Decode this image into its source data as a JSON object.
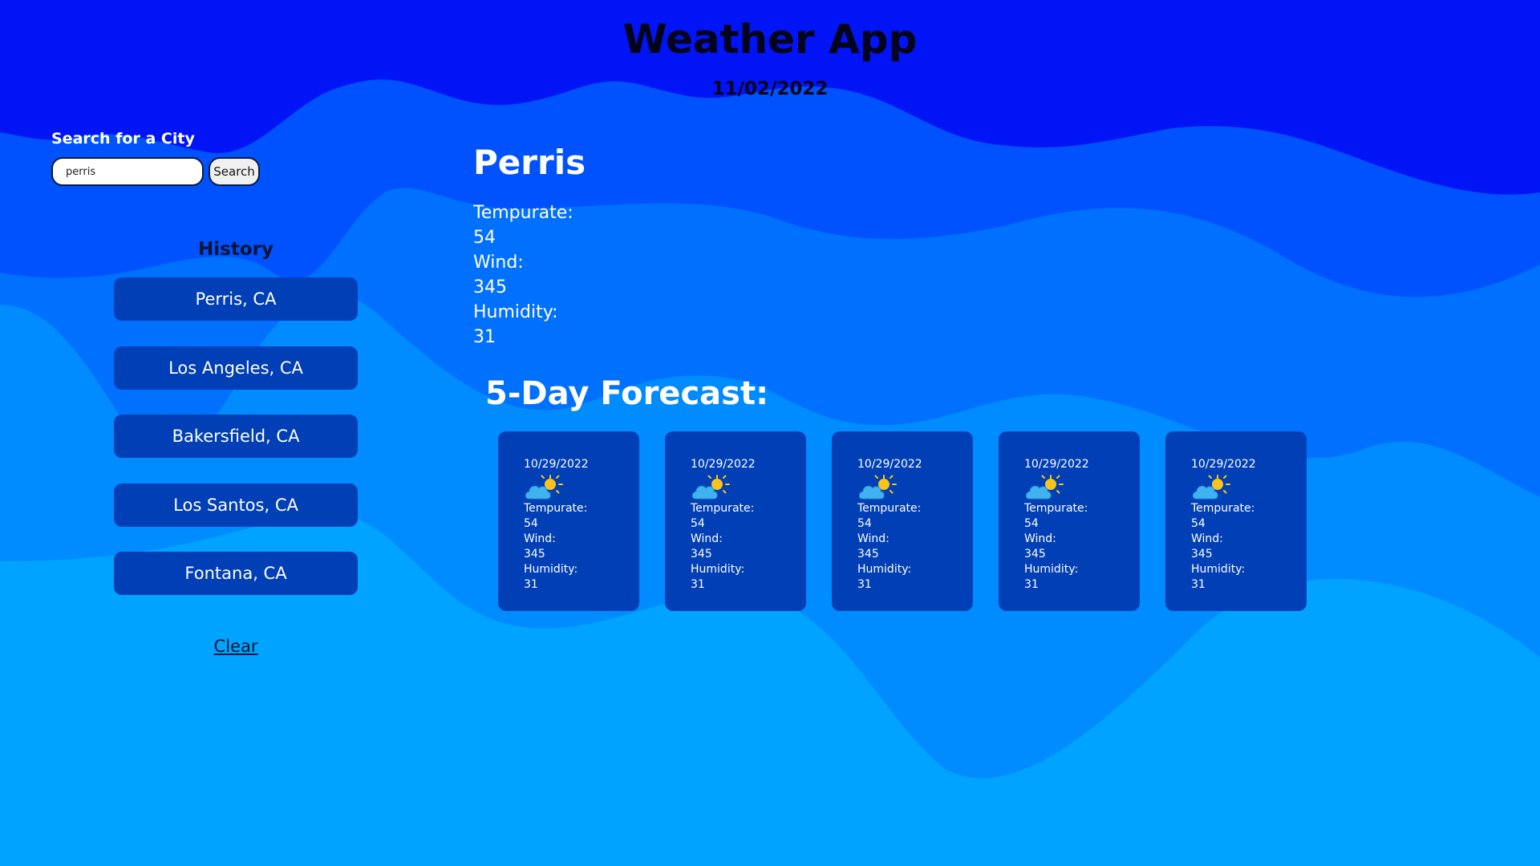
{
  "header": {
    "title": "Weather App",
    "date": "11/02/2022"
  },
  "search": {
    "label": "Search for a City",
    "input_value": "perris",
    "button_label": "Search"
  },
  "history": {
    "title": "History",
    "items": [
      "Perris, CA",
      "Los Angeles, CA",
      "Bakersfield, CA",
      "Los Santos, CA",
      "Fontana, CA"
    ],
    "clear_label": "Clear"
  },
  "current": {
    "city": "Perris",
    "temp_label": "Tempurate:",
    "temp_value": "54",
    "wind_label": "Wind:",
    "wind_value": "345",
    "humidity_label": "Humidity:",
    "humidity_value": "31"
  },
  "forecast": {
    "title": "5-Day Forecast:",
    "icon": "partly-cloudy-icon",
    "days": [
      {
        "date": "10/29/2022",
        "temp_label": "Tempurate:",
        "temp": "54",
        "wind_label": "Wind:",
        "wind": "345",
        "humidity_label": "Humidity:",
        "humidity": "31"
      },
      {
        "date": "10/29/2022",
        "temp_label": "Tempurate:",
        "temp": "54",
        "wind_label": "Wind:",
        "wind": "345",
        "humidity_label": "Humidity:",
        "humidity": "31"
      },
      {
        "date": "10/29/2022",
        "temp_label": "Tempurate:",
        "temp": "54",
        "wind_label": "Wind:",
        "wind": "345",
        "humidity_label": "Humidity:",
        "humidity": "31"
      },
      {
        "date": "10/29/2022",
        "temp_label": "Tempurate:",
        "temp": "54",
        "wind_label": "Wind:",
        "wind": "345",
        "humidity_label": "Humidity:",
        "humidity": "31"
      },
      {
        "date": "10/29/2022",
        "temp_label": "Tempurate:",
        "temp": "54",
        "wind_label": "Wind:",
        "wind": "345",
        "humidity_label": "Humidity:",
        "humidity": "31"
      }
    ]
  },
  "colors": {
    "wave_1": "#0014f5",
    "wave_2": "#0052ff",
    "wave_3": "#0070ff",
    "wave_4": "#008bff",
    "wave_5": "#00a3ff",
    "wave_6": "#00baff",
    "card": "#003fb5"
  }
}
